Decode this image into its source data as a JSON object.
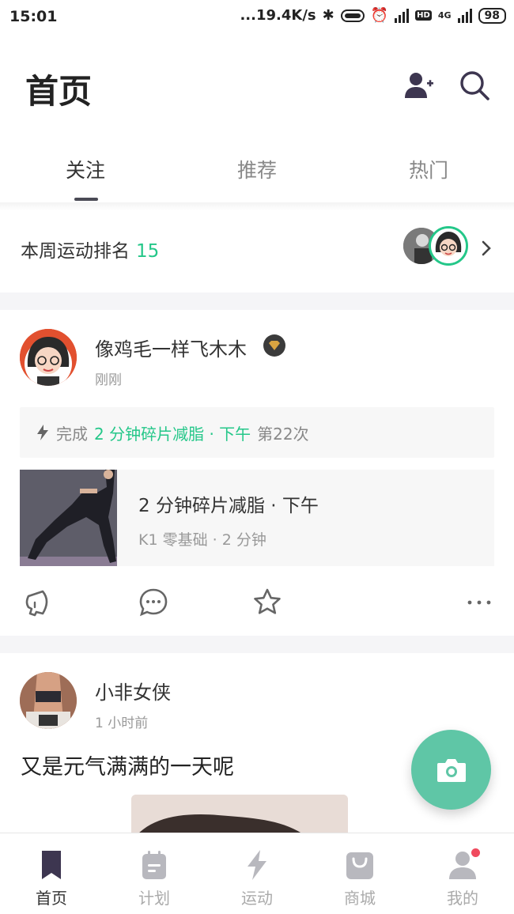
{
  "status_bar": {
    "time": "15:01",
    "network_speed": "...19.4K/s",
    "battery": "98",
    "signal_label": "4G"
  },
  "header": {
    "title": "首页",
    "icons": [
      "add-friend-icon",
      "search-icon"
    ]
  },
  "tabs": [
    {
      "label": "关注",
      "active": true
    },
    {
      "label": "推荐",
      "active": false
    },
    {
      "label": "热门",
      "active": false
    }
  ],
  "weekly_rank": {
    "label": "本周运动排名",
    "value": "15"
  },
  "posts": [
    {
      "user": "像鸡毛一样飞木木",
      "time": "刚刚",
      "badge": "diamond-badge-icon",
      "completion": {
        "prefix": "完成",
        "course": "2 分钟碎片减脂 · 下午",
        "count": "第22次"
      },
      "course_card": {
        "title": "2 分钟碎片减脂 · 下午",
        "subtitle": "K1 零基础 · 2 分钟"
      },
      "actions": [
        "cheer-icon",
        "comment-icon",
        "favorite-icon",
        "more-icon"
      ]
    },
    {
      "user": "小非女侠",
      "time": "1 小时前",
      "text": "又是元气满满的一天呢"
    }
  ],
  "fab": {
    "icon": "camera-icon"
  },
  "bottom_nav": [
    {
      "label": "首页",
      "icon": "home-bookmark-icon",
      "active": true
    },
    {
      "label": "计划",
      "icon": "calendar-plan-icon",
      "active": false
    },
    {
      "label": "运动",
      "icon": "lightning-icon",
      "active": false
    },
    {
      "label": "商城",
      "icon": "shopping-bag-icon",
      "active": false
    },
    {
      "label": "我的",
      "icon": "profile-icon",
      "active": false,
      "badge_dot": true
    }
  ],
  "colors": {
    "accent_green": "#24c789",
    "fab": "#5fc6a6",
    "notification_dot": "#f04a5e"
  }
}
